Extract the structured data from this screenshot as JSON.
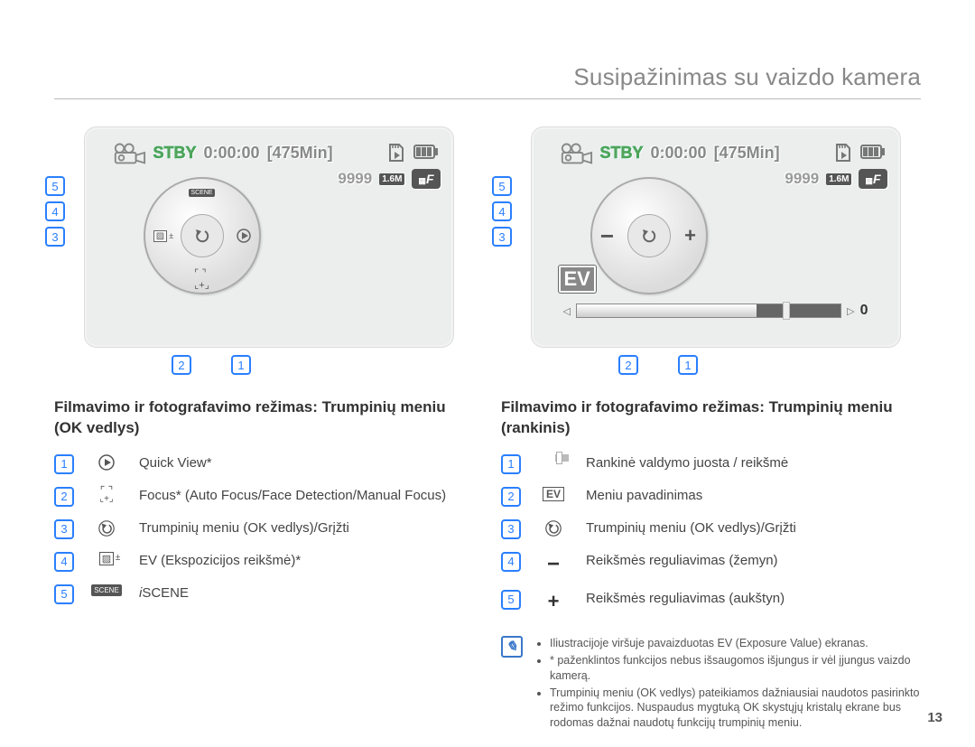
{
  "header": {
    "title": "Susipažinimas su vaizdo kamera"
  },
  "page_number": "13",
  "screens": {
    "common": {
      "stby": "STBY",
      "timecode": "0:00:00",
      "remain": "[475Min]",
      "shots": "9999",
      "res_badge": "1.6M",
      "f_badge": "F"
    },
    "right": {
      "ev_label": "EV",
      "ev_value": "0"
    }
  },
  "callout_stack": [
    "5",
    "4",
    "3"
  ],
  "callout_bottom": [
    "2",
    "1"
  ],
  "left": {
    "heading": "Filmavimo ir fotografavimo režimas: Trumpinių meniu (OK vedlys)",
    "items": [
      {
        "n": "1",
        "icon_name": "play-icon",
        "text": "Quick View*"
      },
      {
        "n": "2",
        "icon_name": "focus-icon",
        "text": "Focus* (Auto Focus/Face Detection/Manual Focus)"
      },
      {
        "n": "3",
        "icon_name": "undo-icon",
        "text": "Trumpinių meniu (OK vedlys)/Grįžti"
      },
      {
        "n": "4",
        "icon_name": "ev-icon",
        "text": "EV (Ekspozicijos reikšmė)*"
      },
      {
        "n": "5",
        "icon_name": "scene-icon",
        "text": "iSCENE"
      }
    ]
  },
  "right": {
    "heading": "Filmavimo ir fotografavimo režimas: Trumpinių meniu (rankinis)",
    "items": [
      {
        "n": "1",
        "icon_name": "slider-icon",
        "text": "Rankinė valdymo juosta / reikšmė"
      },
      {
        "n": "2",
        "icon_name": "ev-badge-icon",
        "text": "Meniu pavadinimas"
      },
      {
        "n": "3",
        "icon_name": "undo-icon",
        "text": "Trumpinių meniu (OK vedlys)/Grįžti"
      },
      {
        "n": "4",
        "icon_name": "minus-icon",
        "text": "Reikšmės reguliavimas (žemyn)"
      },
      {
        "n": "5",
        "icon_name": "plus-icon",
        "text": "Reikšmės reguliavimas (aukštyn)"
      }
    ]
  },
  "note": {
    "bullets": [
      "Iliustracijoje viršuje pavaizduotas EV (Exposure Value) ekranas.",
      "* paženklintos funkcijos nebus išsaugomos išjungus ir vėl įjungus vaizdo kamerą.",
      "Trumpinių meniu (OK vedlys) pateikiamos dažniausiai naudotos pasirinkto režimo funkcijos. Nuspaudus mygtuką OK skystųjų kristalų ekrane bus rodomas dažnai naudotų funkcijų trumpinių meniu."
    ]
  }
}
